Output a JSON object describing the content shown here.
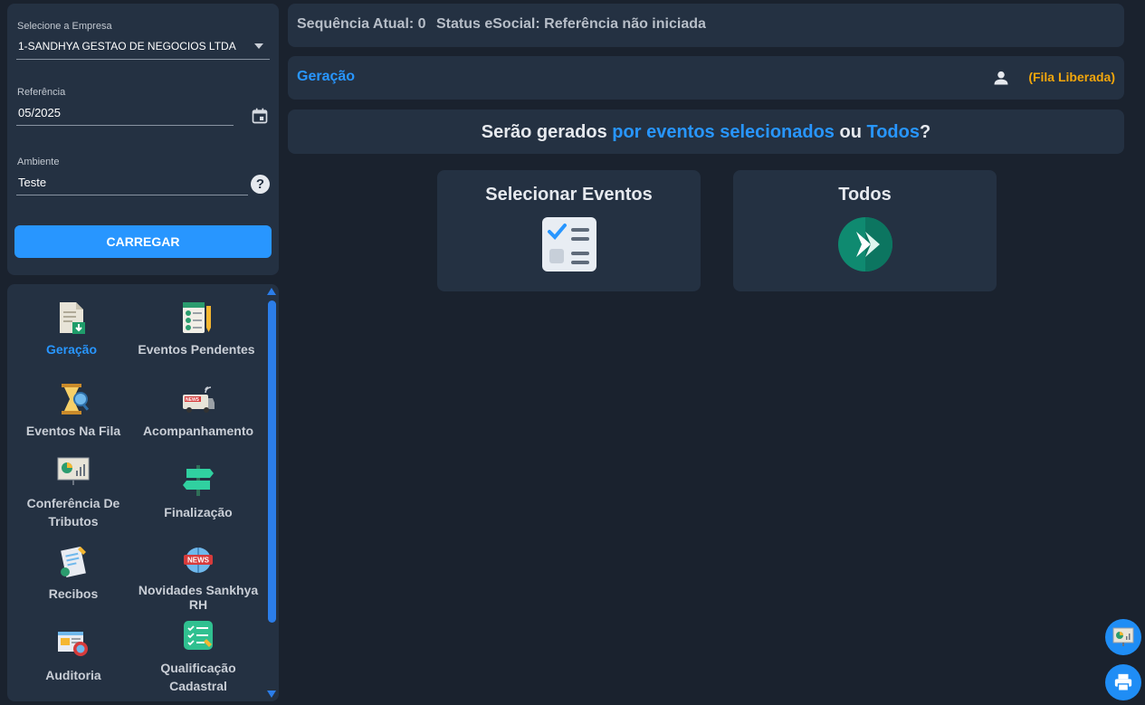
{
  "form": {
    "company_label": "Selecione a Empresa",
    "company_value": "1-SANDHYA GESTAO DE NEGOCIOS LTDA",
    "reference_label": "Referência",
    "reference_value": "05/2025",
    "environment_label": "Ambiente",
    "environment_value": "Teste",
    "load_button": "CARREGAR"
  },
  "menu": {
    "items": [
      {
        "label": "Geração",
        "icon": "document-download-icon",
        "active": true
      },
      {
        "label": "Eventos Pendentes",
        "icon": "checklist-pencil-icon"
      },
      {
        "label": "Eventos Na Fila",
        "icon": "hourglass-search-icon"
      },
      {
        "label": "Acompanhamento",
        "icon": "news-van-icon"
      },
      {
        "label": "Conferência De Tributos",
        "icon": "presentation-chart-icon"
      },
      {
        "label": "Finalização",
        "icon": "signpost-icon"
      },
      {
        "label": "Recibos",
        "icon": "receipt-icon"
      },
      {
        "label": "Novidades Sankhya RH",
        "icon": "news-globe-icon"
      },
      {
        "label": "Auditoria",
        "icon": "audit-search-icon"
      },
      {
        "label": "Qualificação Cadastral",
        "icon": "qualification-checklist-icon"
      }
    ]
  },
  "status": {
    "sequence": "Sequência Atual: 0",
    "esocial": "Status eSocial: Referência não iniciada"
  },
  "generation": {
    "title": "Geração",
    "queue_status": "(Fila Liberada)"
  },
  "question": {
    "part1": "Serão gerados ",
    "part2": "por eventos selecionados",
    "part3": " ou ",
    "part4": "Todos",
    "part5": "?"
  },
  "cards": {
    "select_title": "Selecionar Eventos",
    "all_title": "Todos"
  },
  "colors": {
    "background": "#1a222e",
    "panel": "#243142",
    "accent": "#2896ff",
    "warning": "#f2a60c"
  }
}
